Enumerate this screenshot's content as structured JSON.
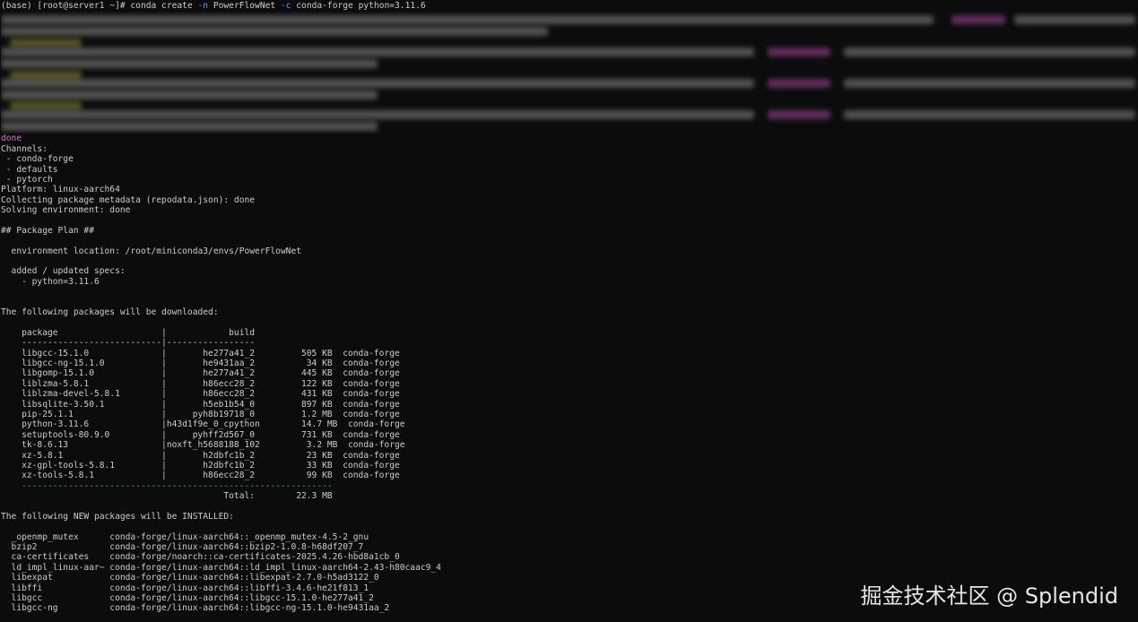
{
  "prompt": {
    "base": "(base) [root@server1 ~]# ",
    "cmd_pre": "conda create ",
    "flag_n": "-n",
    "env_name": " PowerFlowNet ",
    "flag_c": "-c",
    "cmd_post": " conda-forge python=3.11.6"
  },
  "progress_done": "done",
  "channels_header": "Channels:",
  "channels": [
    " - conda-forge",
    " - defaults",
    " - pytorch"
  ],
  "platform": "Platform: linux-aarch64",
  "collecting": "Collecting package metadata (repodata.json): done",
  "solving": "Solving environment: done",
  "plan_title": "## Package Plan ##",
  "env_location": "  environment location: /root/miniconda3/envs/PowerFlowNet",
  "specs_header": "  added / updated specs:",
  "specs": [
    "    - python=3.11.6"
  ],
  "download_header": "The following packages will be downloaded:",
  "download_table": {
    "header": "    package                    |            build",
    "separator": "    ---------------------------|-----------------",
    "rows": [
      "    libgcc-15.1.0              |       he277a41_2         505 KB  conda-forge",
      "    libgcc-ng-15.1.0           |       he9431aa_2          34 KB  conda-forge",
      "    libgomp-15.1.0             |       he277a41_2         445 KB  conda-forge",
      "    liblzma-5.8.1              |       h86ecc28_2         122 KB  conda-forge",
      "    liblzma-devel-5.8.1        |       h86ecc28_2         431 KB  conda-forge",
      "    libsqlite-3.50.1           |       h5eb1b54_0         897 KB  conda-forge",
      "    pip-25.1.1                 |     pyh8b19718_0         1.2 MB  conda-forge",
      "    python-3.11.6              |h43d1f9e_0_cpython        14.7 MB  conda-forge",
      "    setuptools-80.9.0          |     pyhff2d567_0         731 KB  conda-forge",
      "    tk-8.6.13                  |noxft_h5688188_102         3.2 MB  conda-forge",
      "    xz-5.8.1                   |       h2dbfc1b_2          23 KB  conda-forge",
      "    xz-gpl-tools-5.8.1         |       h2dbfc1b_2          33 KB  conda-forge",
      "    xz-tools-5.8.1             |       h86ecc28_2          99 KB  conda-forge"
    ],
    "footer_sep": "    ------------------------------------------------------------",
    "total": "                                           Total:        22.3 MB"
  },
  "install_header": "The following NEW packages will be INSTALLED:",
  "install_rows": [
    "  _openmp_mutex      conda-forge/linux-aarch64::_openmp_mutex-4.5-2_gnu",
    "  bzip2              conda-forge/linux-aarch64::bzip2-1.0.8-h68df207_7",
    "  ca-certificates    conda-forge/noarch::ca-certificates-2025.4.26-hbd8a1cb_0",
    "  ld_impl_linux-aar~ conda-forge/linux-aarch64::ld_impl_linux-aarch64-2.43-h80caac9_4",
    "  libexpat           conda-forge/linux-aarch64::libexpat-2.7.0-h5ad3122_0",
    "  libffi             conda-forge/linux-aarch64::libffi-3.4.6-he21f813_1",
    "  libgcc             conda-forge/linux-aarch64::libgcc-15.1.0-he277a41_2",
    "  libgcc-ng          conda-forge/linux-aarch64::libgcc-ng-15.1.0-he9431aa_2"
  ],
  "watermark": "掘金技术社区 @ Splendid",
  "colors": {
    "background": "#0c0c0c",
    "text": "#cccccc",
    "flag": "#5c9cf5",
    "done": "#d670d6",
    "separator": "#3aa6b9"
  }
}
